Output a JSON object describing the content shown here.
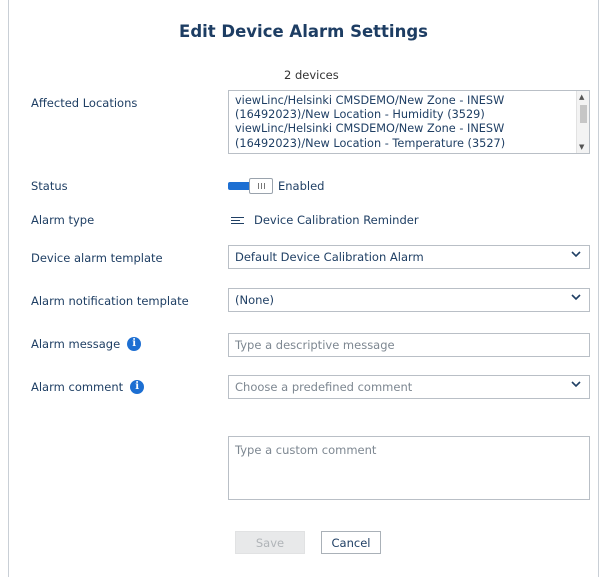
{
  "dialog": {
    "title": "Edit Device Alarm Settings",
    "device_count": "2 devices"
  },
  "labels": {
    "affected_locations": "Affected Locations",
    "status": "Status",
    "alarm_type": "Alarm type",
    "device_alarm_template": "Device alarm template",
    "alarm_notification_template": "Alarm notification template",
    "alarm_message": "Alarm message",
    "alarm_comment": "Alarm comment"
  },
  "locations": [
    "viewLinc/Helsinki CMSDEMO/New Zone - INESW",
    "(16492023)/New Location - Humidity (3529)",
    "viewLinc/Helsinki CMSDEMO/New Zone - INESW",
    "(16492023)/New Location - Temperature (3527)"
  ],
  "status": {
    "value": "Enabled",
    "enabled": true
  },
  "alarm_type": {
    "value": "Device Calibration Reminder",
    "icon": "list-settings-icon"
  },
  "device_alarm_template": {
    "value": "Default Device Calibration Alarm"
  },
  "alarm_notification_template": {
    "value": "(None)"
  },
  "alarm_message": {
    "placeholder": "Type a descriptive message"
  },
  "alarm_comment": {
    "placeholder": "Choose a predefined comment",
    "custom_placeholder": "Type a custom comment"
  },
  "buttons": {
    "save": "Save",
    "cancel": "Cancel"
  },
  "colors": {
    "accent": "#1d6fd2",
    "text": "#1f3f64",
    "border": "#b9bfc6"
  }
}
